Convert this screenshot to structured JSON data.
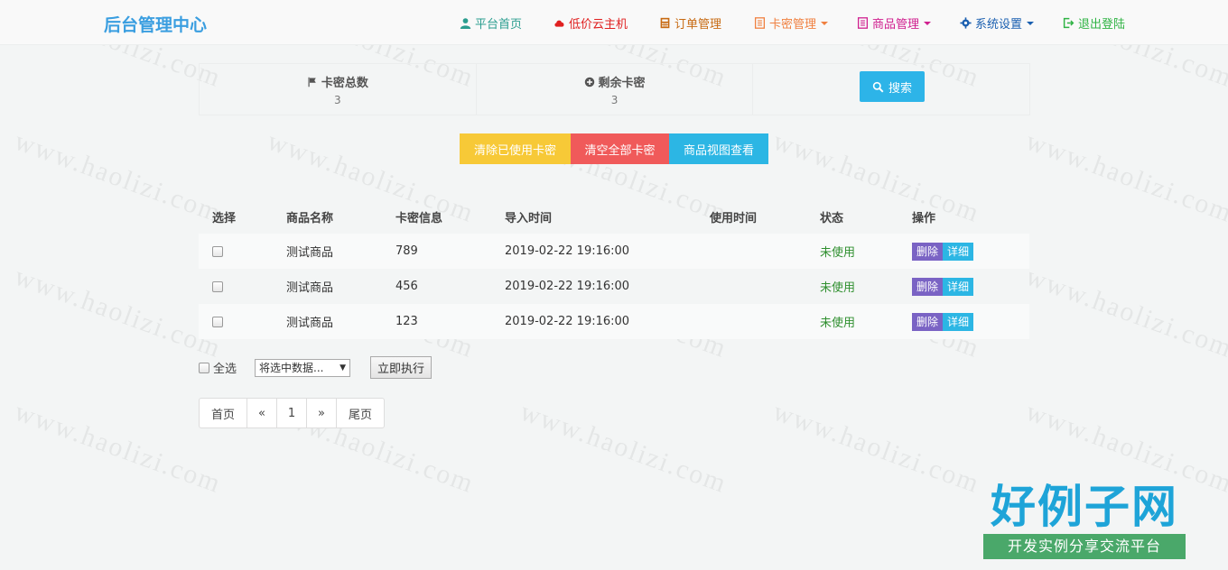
{
  "navbar": {
    "brand": "后台管理中心",
    "items": [
      {
        "label": "平台首页",
        "icon": "user-icon",
        "color": "#2a9d8f"
      },
      {
        "label": "低价云主机",
        "icon": "cloud-icon",
        "color": "#e02020"
      },
      {
        "label": "订单管理",
        "icon": "calculator-icon",
        "color": "#c76a12"
      },
      {
        "label": "卡密管理",
        "icon": "list-icon",
        "color": "#f08040",
        "dropdown": true
      },
      {
        "label": "商品管理",
        "icon": "list-icon",
        "color": "#d0208f",
        "dropdown": true
      },
      {
        "label": "系统设置",
        "icon": "gear-icon",
        "color": "#1a5fb0",
        "dropdown": true
      },
      {
        "label": "退出登陆",
        "icon": "sign-out-icon",
        "color": "#2fb344"
      }
    ]
  },
  "stats": {
    "total": {
      "label": "卡密总数",
      "value": "3",
      "icon": "flag-icon"
    },
    "remaining": {
      "label": "剩余卡密",
      "value": "3",
      "icon": "plus-circle-icon"
    },
    "search_label": "搜索"
  },
  "actions": {
    "clear_used": "清除已使用卡密",
    "clear_all": "清空全部卡密",
    "view_by_product": "商品视图查看"
  },
  "table": {
    "headers": {
      "select": "选择",
      "name": "商品名称",
      "info": "卡密信息",
      "import_time": "导入时间",
      "use_time": "使用时间",
      "status": "状态",
      "ops": "操作"
    },
    "rows": [
      {
        "name": "测试商品",
        "info": "789",
        "import_time": "2019-02-22 19:16:00",
        "use_time": "",
        "status": "未使用",
        "del": "删除",
        "detail": "详细"
      },
      {
        "name": "测试商品",
        "info": "456",
        "import_time": "2019-02-22 19:16:00",
        "use_time": "",
        "status": "未使用",
        "del": "删除",
        "detail": "详细"
      },
      {
        "name": "测试商品",
        "info": "123",
        "import_time": "2019-02-22 19:16:00",
        "use_time": "",
        "status": "未使用",
        "del": "删除",
        "detail": "详细"
      }
    ]
  },
  "bulk": {
    "select_all": "全选",
    "select_placeholder": "将选中数据...",
    "execute": "立即执行"
  },
  "pagination": {
    "first": "首页",
    "prev": "«",
    "current": "1",
    "next": "»",
    "last": "尾页"
  },
  "watermark": {
    "text": "www.haolizi.com",
    "logo_big": "好例子网",
    "logo_small": "开发实例分享交流平台"
  }
}
